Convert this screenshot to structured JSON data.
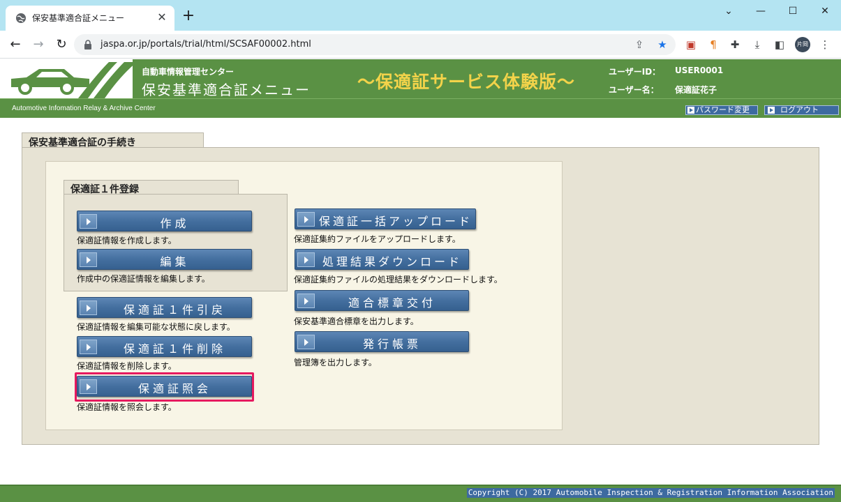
{
  "browser": {
    "tab_title": "保安基準適合証メニュー",
    "tab_close": "✕",
    "new_tab": "+",
    "window_controls": {
      "minimize": "⌄",
      "min": "—",
      "max": "☐",
      "close": "✕"
    },
    "url": "jaspa.or.jp/portals/trial/html/SCSAF00002.html",
    "profile_label": "片岡"
  },
  "site": {
    "org_name": "自動車情報管理センター",
    "system_name": "保安基準適合証メニュー",
    "trial_title": "～保適証サービス体験版～",
    "user_id_label": "ユーザーID：",
    "user_id": "USER0001",
    "user_name_label": "ユーザー名：",
    "user_name": "保適証花子",
    "org_en": "Automotive Infomation Relay & Archive Center",
    "password_change": "パスワード変更",
    "logout": "ログアウト"
  },
  "main": {
    "section_title": "保安基準適合証の手続き",
    "single_title": "保適証１件登録",
    "buttons": {
      "create": {
        "label": "作成",
        "desc": "保適証情報を作成します。"
      },
      "edit": {
        "label": "編集",
        "desc": "作成中の保適証情報を編集します。"
      },
      "revert": {
        "label": "保適証１件引戻",
        "desc": "保適証情報を編集可能な状態に戻します。"
      },
      "delete": {
        "label": "保適証１件削除",
        "desc": "保適証情報を削除します。"
      },
      "inquiry": {
        "label": "保適証照会",
        "desc": "保適証情報を照会します。"
      },
      "bulk_upload": {
        "label": "保適証一括アップロード",
        "desc": "保適証集約ファイルをアップロードします。"
      },
      "result_download": {
        "label": "処理結果ダウンロード",
        "desc": "保適証集約ファイルの処理結果をダウンロードします。"
      },
      "sticker_issue": {
        "label": "適合標章交付",
        "desc": "保安基準適合標章を出力します。"
      },
      "ledger_issue": {
        "label": "発行帳票",
        "desc": "管理簿を出力します。"
      }
    }
  },
  "footer": {
    "copyright": "Copyright (C) 2017 Automobile Inspection & Registration Information Association"
  },
  "colors": {
    "header_green": "#5a9144",
    "button_blue": "#446f9f",
    "highlight": "#e6195f",
    "title_yellow": "#f3d34a"
  }
}
